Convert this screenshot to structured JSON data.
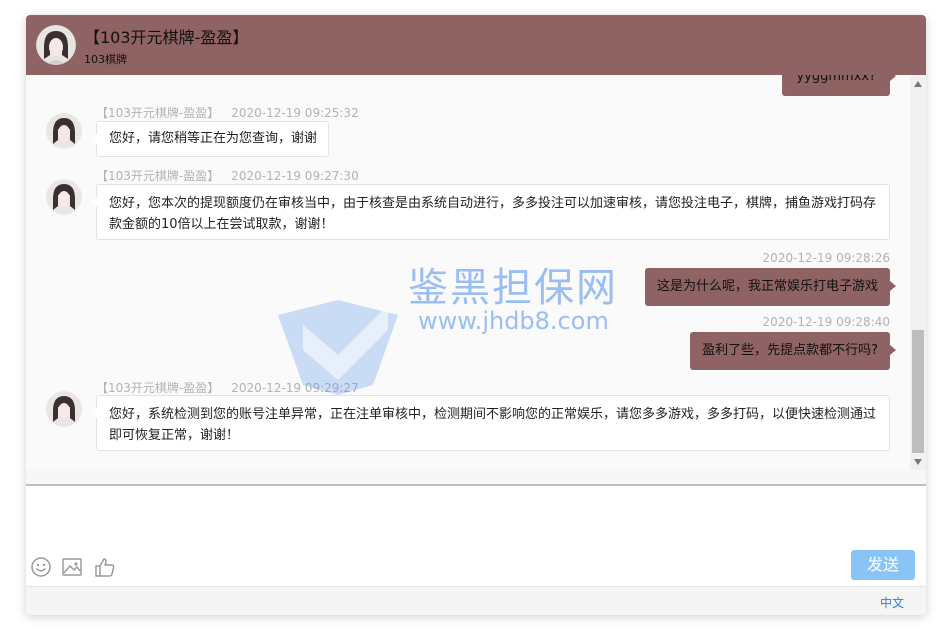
{
  "header": {
    "title": "【103开元棋牌-盈盈】",
    "subtitle": "103棋牌"
  },
  "messages": [
    {
      "side": "right",
      "text": "yyggmmxx?",
      "partial": true
    },
    {
      "side": "left",
      "sender": "【103开元棋牌-盈盈】",
      "time": "2020-12-19 09:25:32",
      "text": "您好，请您稍等正在为您查询，谢谢"
    },
    {
      "side": "left",
      "sender": "【103开元棋牌-盈盈】",
      "time": "2020-12-19 09:27:30",
      "text": "您好，您本次的提现额度仍在审核当中，由于核查是由系统自动进行，多多投注可以加速审核，请您投注电子，棋牌，捕鱼游戏打码存款金额的10倍以上在尝试取款，谢谢！"
    },
    {
      "side": "right",
      "time": "2020-12-19 09:28:26",
      "text": "这是为什么呢，我正常娱乐打电子游戏"
    },
    {
      "side": "right",
      "time": "2020-12-19 09:28:40",
      "text": "盈利了些，先提点款都不行吗?"
    },
    {
      "side": "left",
      "sender": "【103开元棋牌-盈盈】",
      "time": "2020-12-19 09:29:27",
      "text": "您好，系统检测到您的账号注单异常，正在注单审核中，检测期间不影响您的正常娱乐，请您多多游戏，多多打码，以便快速检测通过即可恢复正常，谢谢！"
    }
  ],
  "composer": {
    "placeholder": "",
    "tools": [
      "emoji-icon",
      "image-icon",
      "thumbs-up-icon"
    ],
    "send_label": "发送"
  },
  "footer": {
    "language": "中文"
  },
  "watermark": {
    "name": "鉴黑担保网",
    "url": "www.jhdb8.com"
  },
  "colors": {
    "header": "#8f6263",
    "outgoing_bubble": "#8f6263",
    "send_button": "#89c4f4",
    "link": "#2f7fd6"
  }
}
